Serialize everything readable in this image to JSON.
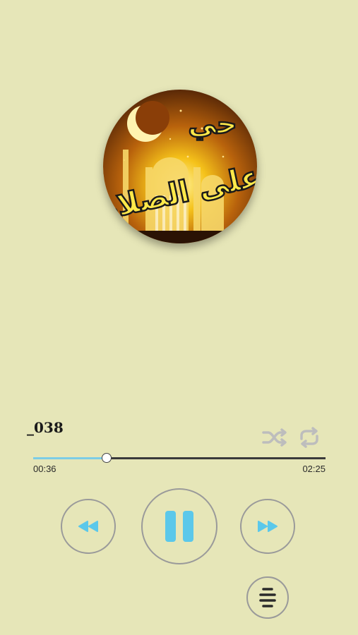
{
  "album_art": {
    "text_top": "حي",
    "text_bottom": "على الصلاة"
  },
  "track": {
    "title": "_038"
  },
  "player": {
    "current_time": "00:36",
    "total_time": "02:25",
    "progress": 0.25
  },
  "icons": {
    "shuffle": "shuffle-icon",
    "repeat": "repeat-icon",
    "rewind": "rewind-icon",
    "pause": "pause-icon",
    "fast_forward": "fast-forward-icon",
    "playlist": "playlist-icon"
  },
  "colors": {
    "background": "#e6e6b8",
    "accent": "#5bc8ea",
    "progress_fill": "#7ccde6",
    "inactive_icon": "#bdbdbd"
  }
}
